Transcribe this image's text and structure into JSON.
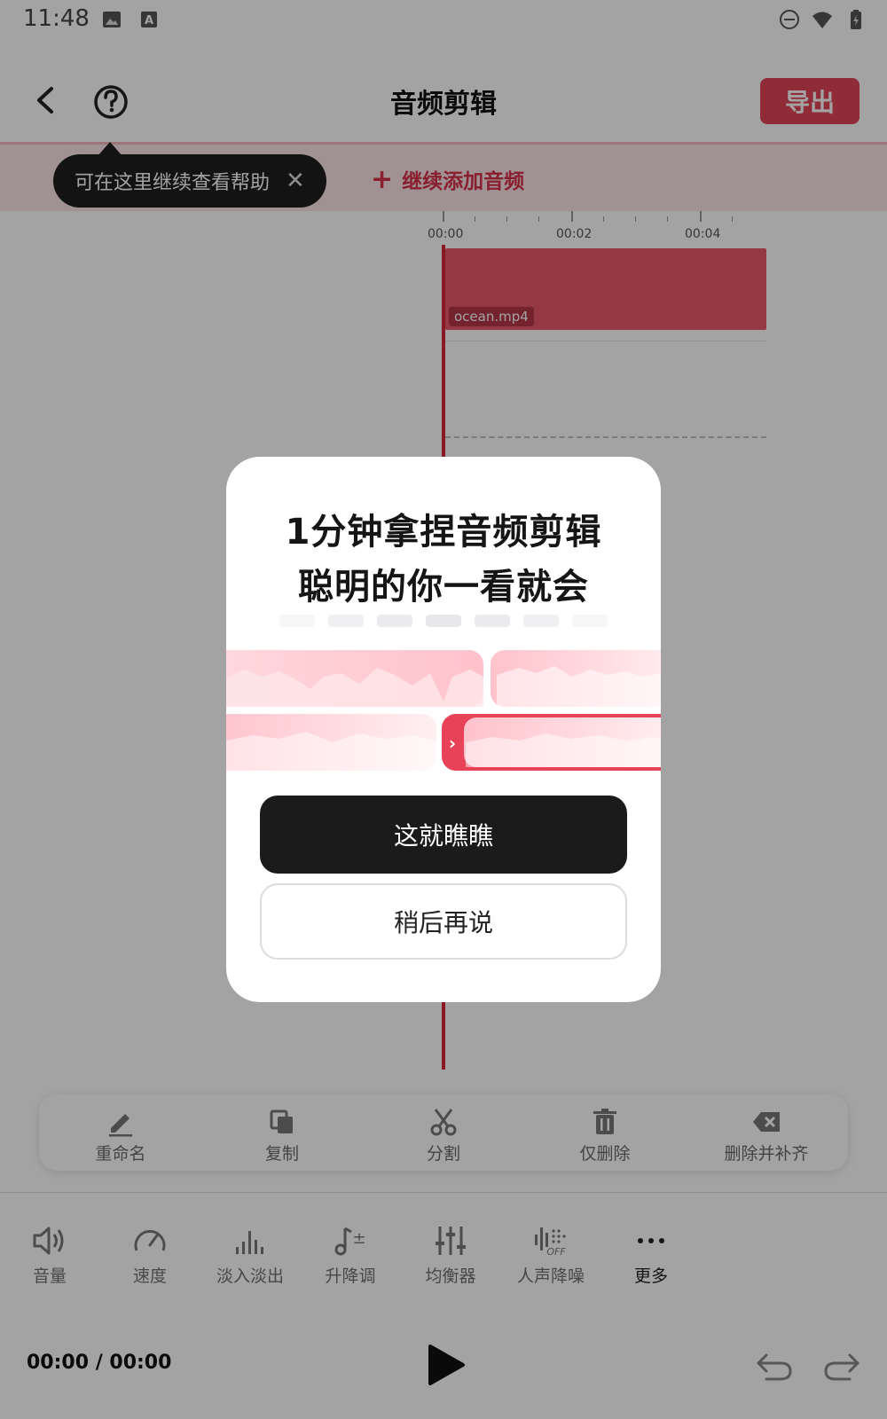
{
  "status_bar": {
    "time": "11:48"
  },
  "header": {
    "title": "音频剪辑",
    "export_label": "导出"
  },
  "tooltip": {
    "text": "可在这里继续查看帮助"
  },
  "add_audio": {
    "label": "继续添加音频"
  },
  "timeline": {
    "ticks": [
      "00:00",
      "00:02",
      "00:04"
    ],
    "clip_name": "ocean.mp4"
  },
  "edit_toolbar": {
    "rename": "重命名",
    "copy": "复制",
    "split": "分割",
    "delete_only": "仅删除",
    "delete_fill": "删除并补齐"
  },
  "tools": {
    "volume": "音量",
    "speed": "速度",
    "fade": "淡入淡出",
    "pitch": "升降调",
    "equalizer": "均衡器",
    "denoise": "人声降噪",
    "more": "更多"
  },
  "playback": {
    "time": "00:00 / 00:00"
  },
  "modal": {
    "title_line1": "1分钟拿捏音频剪辑",
    "title_line2": "聪明的你一看就会",
    "primary_button": "这就瞧瞧",
    "secondary_button": "稍后再说"
  },
  "colors": {
    "accent": "#e04557",
    "playhead": "#d8283b",
    "clip": "#e85a6a"
  }
}
